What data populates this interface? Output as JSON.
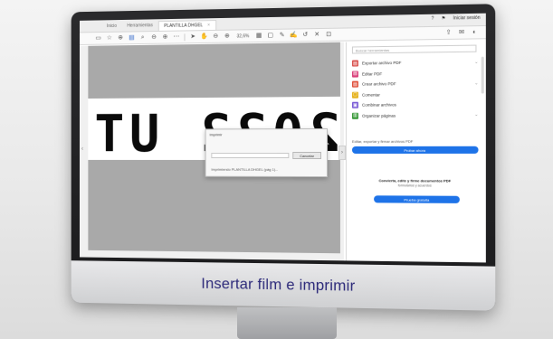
{
  "tabs": [
    "Inicio",
    "Herramientas",
    "PLANTILLA DHGEL"
  ],
  "tab_close": "×",
  "header": {
    "help_icon": "?",
    "bell_icon": "🔔",
    "signin_label": "Iniciar sesión"
  },
  "toolbar": {
    "zoom": "32,6%",
    "icons": [
      "save-icon",
      "star-icon",
      "upload-icon",
      "print-icon",
      "zoom-icon",
      "prev-page-icon",
      "next-page-icon",
      "page-nav-icon",
      "cursor-icon",
      "hand-icon",
      "zoom-out-icon",
      "zoom-in-icon",
      "fit-icon",
      "comment-icon",
      "highlight-icon",
      "sign-icon",
      "undo-icon",
      "delete-icon",
      "more-icon"
    ]
  },
  "document": {
    "mirrored_text": "2022 UTE",
    "left_arrow": "‹",
    "right_arrow": "›"
  },
  "dialog": {
    "title": "Imprimir",
    "button_label": "Cancelar",
    "status": "Imprimiendo PLANTILLA DHGEL (pág 1)..."
  },
  "right_pane": {
    "search_placeholder": "Buscar herramientas",
    "tools": [
      {
        "label": "Exportar archivo PDF",
        "color": "#d9534f"
      },
      {
        "label": "Editar PDF",
        "color": "#d9407a"
      },
      {
        "label": "Crear archivo PDF",
        "color": "#e0503b"
      },
      {
        "label": "Comentar",
        "color": "#e6b422"
      },
      {
        "label": "Combinar archivos",
        "color": "#7a5bd6"
      },
      {
        "label": "Organizar páginas",
        "color": "#3a9a3a"
      }
    ],
    "convert_text": "Editar, exportar y firmar archivos PDF",
    "convert_button": "Probar ahora",
    "promo_title": "Convierta, edite y firme documentos PDF",
    "promo_sub": "formularios y acuerdos",
    "promo_button": "Prueba gratuita"
  },
  "caption": "Insertar film e imprimir"
}
